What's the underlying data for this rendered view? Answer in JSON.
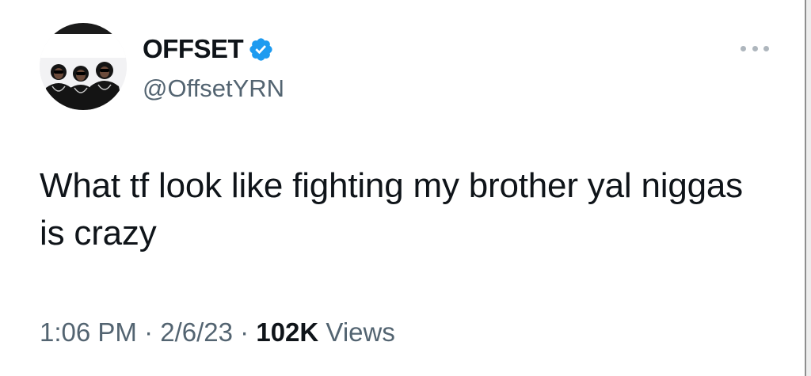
{
  "tweet": {
    "author": {
      "display_name": "OFFSET",
      "handle": "@OffsetYRN",
      "verified": true,
      "avatar_icon": "avatar-photo"
    },
    "more_icon": "more-horizontal-icon",
    "text": "What tf look like fighting my brother yal niggas is crazy",
    "time": "1:06 PM",
    "separator": "·",
    "date": "2/6/23",
    "views_count": "102K",
    "views_label": "Views"
  },
  "colors": {
    "text_primary": "#0f1419",
    "text_secondary": "#536471",
    "verified_blue": "#1d9bf0"
  }
}
